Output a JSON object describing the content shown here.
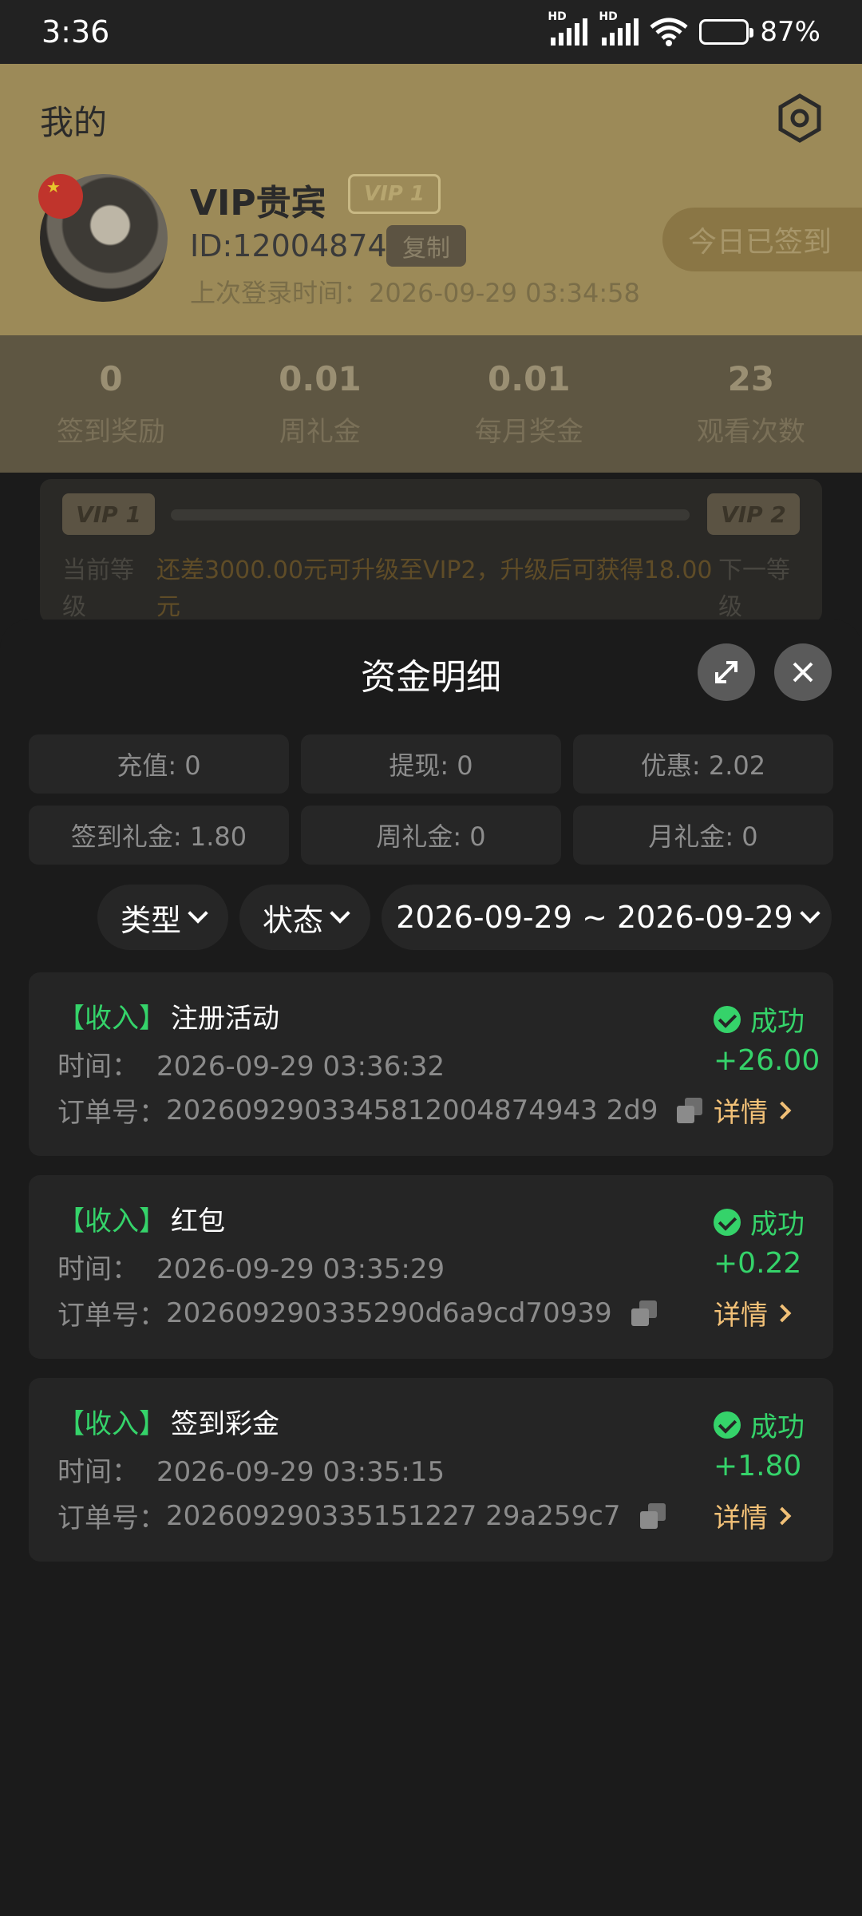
{
  "status_bar": {
    "time": "3:36",
    "battery": "87%"
  },
  "profile": {
    "page_title": "我的",
    "name": "VIP贵宾",
    "vip_badge": "VIP 1",
    "id": "ID:12004874",
    "copy_label": "复制",
    "last_login": "上次登录时间：2026-09-29 03:34:58",
    "signed_label": "今日已签到"
  },
  "stats": [
    {
      "value": "0",
      "label": "签到奖励"
    },
    {
      "value": "0.01",
      "label": "周礼金"
    },
    {
      "value": "0.01",
      "label": "每月奖金"
    },
    {
      "value": "23",
      "label": "观看次数"
    }
  ],
  "vip_progress": {
    "current_badge": "VIP 1",
    "next_badge": "VIP 2",
    "current_label": "当前等级",
    "message": "还差3000.00元可升级至VIP2，升级后可获得18.00元",
    "next_label": "下一等级"
  },
  "sheet": {
    "title": "资金明细",
    "summary": [
      "充值: 0",
      "提现: 0",
      "优惠: 2.02",
      "签到礼金: 1.80",
      "周礼金: 0",
      "月礼金: 0"
    ],
    "filters": {
      "type": "类型",
      "status": "状态",
      "date_range": "2026-09-29 ~ 2026-09-29"
    },
    "records": [
      {
        "tag": "【收入】",
        "name": "注册活动",
        "time_label": "时间：",
        "time": "2026-09-29 03:36:32",
        "order_label": "订单号：",
        "order": "2026092903345812004874943 2d9",
        "status": "成功",
        "amount": "+26.00",
        "detail": "详情"
      },
      {
        "tag": "【收入】",
        "name": "红包",
        "time_label": "时间：",
        "time": "2026-09-29 03:35:29",
        "order_label": "订单号：",
        "order": "202609290335290d6a9cd70939",
        "status": "成功",
        "amount": "+0.22",
        "detail": "详情"
      },
      {
        "tag": "【收入】",
        "name": "签到彩金",
        "time_label": "时间：",
        "time": "2026-09-29 03:35:15",
        "order_label": "订单号：",
        "order": "202609290335151227 29a259c7",
        "status": "成功",
        "amount": "+1.80",
        "detail": "详情"
      }
    ]
  },
  "colors": {
    "success": "#35d36a",
    "detail": "#f1c077",
    "accent_gold": "#9c8a58"
  }
}
